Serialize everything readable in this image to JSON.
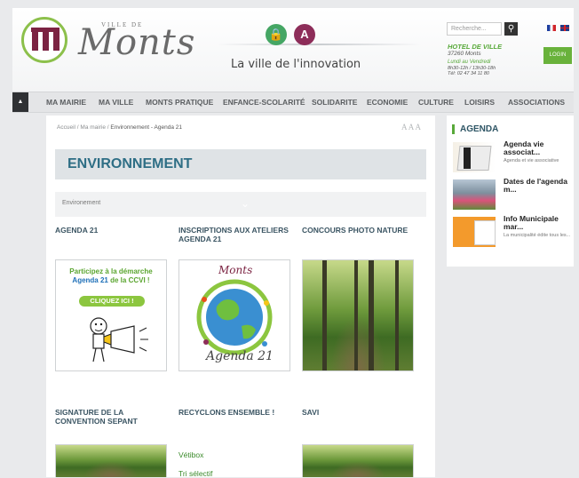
{
  "header": {
    "logo_small": "VILLE DE",
    "logo_name": "Monts",
    "tagline": "La ville de l'innovation",
    "search_placeholder": "Recherche...",
    "hotel": {
      "title": "HOTEL DE VILLE",
      "city": "37260 Monts",
      "days": "Lundi au Vendredi",
      "hours": "8h30-12h / 13h30-18h",
      "tel": "Tél: 02 47 34 11 80"
    },
    "login_label": "LOGIN",
    "icons": {
      "lock": "lock-icon",
      "accessibility": "accessibility-icon",
      "search": "search-icon"
    }
  },
  "nav": {
    "items": [
      "MA MAIRIE",
      "MA VILLE",
      "MONTS PRATIQUE",
      "ENFANCE-SCOLARITÉ",
      "SOLIDARITE",
      "ECONOMIE",
      "CULTURE",
      "LOISIRS",
      "ASSOCIATIONS"
    ]
  },
  "breadcrumb": {
    "home": "Accueil",
    "sep": "/",
    "level1": "Ma mairie",
    "current": "Environnement - Agenda 21"
  },
  "font_sizer": "A A A",
  "page": {
    "title": "ENVIRONNEMENT",
    "subnav": "Environement",
    "cards": [
      {
        "title": "AGENDA 21"
      },
      {
        "title": "INSCRIPTIONS AUX ATELIERS AGENDA 21"
      },
      {
        "title": "CONCOURS PHOTO NATURE"
      },
      {
        "title": "SIGNATURE DE LA CONVENTION SEPANT"
      },
      {
        "title": "RECYCLONS ENSEMBLE !"
      },
      {
        "title": "SAVI"
      }
    ],
    "agenda_card": {
      "line1": "Participez à la démarche",
      "agenda": "Agenda 21",
      "line2": " de la CCVI !",
      "cta": "CLIQUEZ ICI !"
    },
    "workshop_art": {
      "top": "Monts",
      "bottom": "Agenda 21"
    },
    "recycle_links": [
      "Vétibox",
      "Tri sélectif"
    ]
  },
  "sidebar": {
    "title": "AGENDA",
    "items": [
      {
        "title": "Agenda vie associat...",
        "desc": "Agenda et vie associative"
      },
      {
        "title": "Dates de l'agenda m...",
        "desc": ""
      },
      {
        "title": "Info Municipale mar...",
        "desc": "La municipalité édite tous les..."
      }
    ]
  },
  "colors": {
    "brand_green": "#58a93a",
    "brand_purple": "#7b2342",
    "title_blue": "#2e6e85"
  }
}
